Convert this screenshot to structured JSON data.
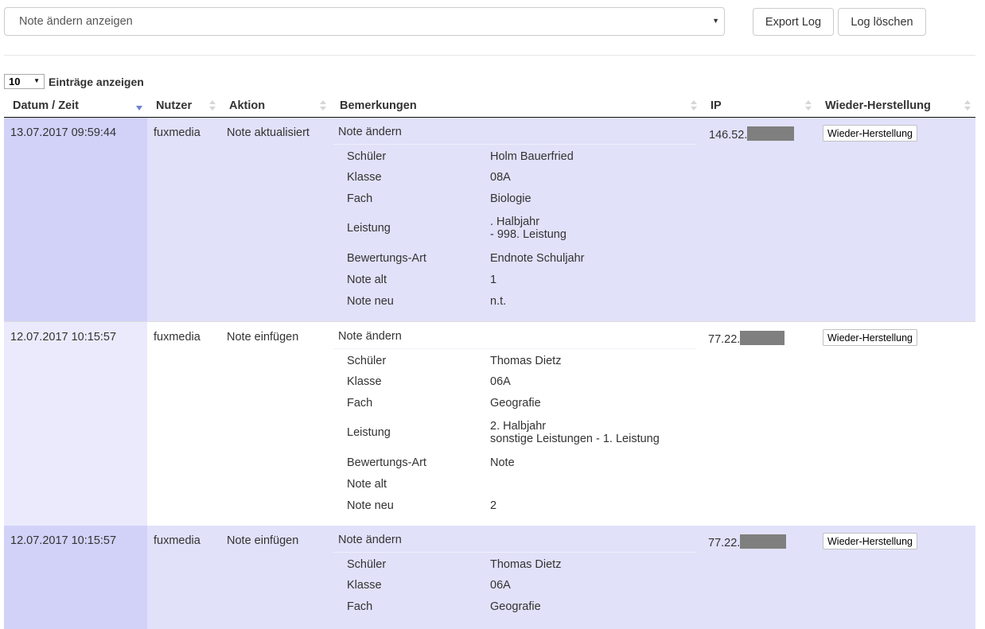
{
  "toolbar": {
    "filter_value": "Note ändern anzeigen",
    "export_label": "Export Log",
    "clear_label": "Log löschen"
  },
  "length": {
    "value": "10",
    "label": "Einträge anzeigen"
  },
  "columns": [
    "Datum / Zeit",
    "Nutzer",
    "Aktion",
    "Bemerkungen",
    "IP",
    "Wieder-Herstellung"
  ],
  "sort": {
    "column": "Datum / Zeit",
    "direction": "descending"
  },
  "rows": [
    {
      "date": "13.07.2017 09:59:44",
      "user": "fuxmedia",
      "action": "Note aktualisiert",
      "remark_title": "Note ändern",
      "details": [
        {
          "k": "Schüler",
          "v": "Holm Bauerfried"
        },
        {
          "k": "Klasse",
          "v": "08A"
        },
        {
          "k": "Fach",
          "v": "Biologie"
        },
        {
          "k": "Leistung",
          "v": ". Halbjahr",
          "v2": "- 998. Leistung"
        },
        {
          "k": "Bewertungs-Art",
          "v": "Endnote Schuljahr"
        },
        {
          "k": "Note alt",
          "v": "1"
        },
        {
          "k": "Note neu",
          "v": "n.t."
        }
      ],
      "ip": "146.52.",
      "restore": "Wieder-Herstellung"
    },
    {
      "date": "12.07.2017 10:15:57",
      "user": "fuxmedia",
      "action": "Note einfügen",
      "remark_title": "Note ändern",
      "details": [
        {
          "k": "Schüler",
          "v": "Thomas Dietz"
        },
        {
          "k": "Klasse",
          "v": "06A"
        },
        {
          "k": "Fach",
          "v": "Geografie"
        },
        {
          "k": "Leistung",
          "v": "2. Halbjahr",
          "v2": "sonstige Leistungen - 1. Leistung"
        },
        {
          "k": "Bewertungs-Art",
          "v": "Note"
        },
        {
          "k": "Note alt",
          "v": ""
        },
        {
          "k": "Note neu",
          "v": "2"
        }
      ],
      "ip": "77.22.",
      "restore": "Wieder-Herstellung"
    },
    {
      "date": "12.07.2017 10:15:57",
      "user": "fuxmedia",
      "action": "Note einfügen",
      "remark_title": "Note ändern",
      "details": [
        {
          "k": "Schüler",
          "v": "Thomas Dietz"
        },
        {
          "k": "Klasse",
          "v": "06A"
        },
        {
          "k": "Fach",
          "v": "Geografie"
        }
      ],
      "ip": "77.22.",
      "restore": "Wieder-Herstellung"
    }
  ],
  "colors": {
    "row_odd": "#e1e1fa",
    "row_odd_sorted": "#d2d2f8",
    "row_even_sorted": "#eaeafc",
    "sort_active": "#6f82cf",
    "ip_mask": "#7f7f7f"
  }
}
